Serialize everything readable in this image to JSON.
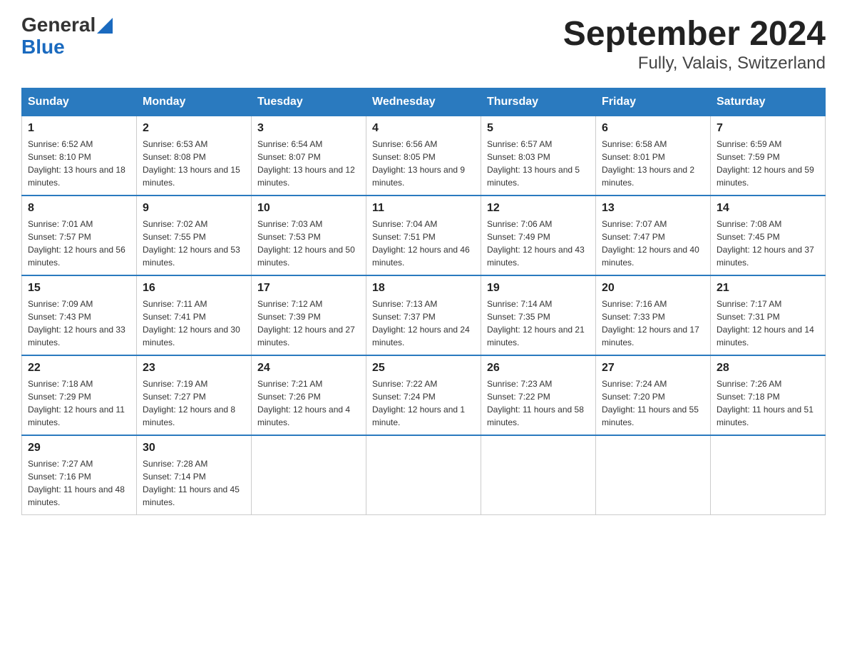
{
  "header": {
    "logo_general": "General",
    "logo_blue": "Blue",
    "month_year": "September 2024",
    "location": "Fully, Valais, Switzerland"
  },
  "days_of_week": [
    "Sunday",
    "Monday",
    "Tuesday",
    "Wednesday",
    "Thursday",
    "Friday",
    "Saturday"
  ],
  "weeks": [
    [
      {
        "day": "1",
        "sunrise": "6:52 AM",
        "sunset": "8:10 PM",
        "daylight": "13 hours and 18 minutes."
      },
      {
        "day": "2",
        "sunrise": "6:53 AM",
        "sunset": "8:08 PM",
        "daylight": "13 hours and 15 minutes."
      },
      {
        "day": "3",
        "sunrise": "6:54 AM",
        "sunset": "8:07 PM",
        "daylight": "13 hours and 12 minutes."
      },
      {
        "day": "4",
        "sunrise": "6:56 AM",
        "sunset": "8:05 PM",
        "daylight": "13 hours and 9 minutes."
      },
      {
        "day": "5",
        "sunrise": "6:57 AM",
        "sunset": "8:03 PM",
        "daylight": "13 hours and 5 minutes."
      },
      {
        "day": "6",
        "sunrise": "6:58 AM",
        "sunset": "8:01 PM",
        "daylight": "13 hours and 2 minutes."
      },
      {
        "day": "7",
        "sunrise": "6:59 AM",
        "sunset": "7:59 PM",
        "daylight": "12 hours and 59 minutes."
      }
    ],
    [
      {
        "day": "8",
        "sunrise": "7:01 AM",
        "sunset": "7:57 PM",
        "daylight": "12 hours and 56 minutes."
      },
      {
        "day": "9",
        "sunrise": "7:02 AM",
        "sunset": "7:55 PM",
        "daylight": "12 hours and 53 minutes."
      },
      {
        "day": "10",
        "sunrise": "7:03 AM",
        "sunset": "7:53 PM",
        "daylight": "12 hours and 50 minutes."
      },
      {
        "day": "11",
        "sunrise": "7:04 AM",
        "sunset": "7:51 PM",
        "daylight": "12 hours and 46 minutes."
      },
      {
        "day": "12",
        "sunrise": "7:06 AM",
        "sunset": "7:49 PM",
        "daylight": "12 hours and 43 minutes."
      },
      {
        "day": "13",
        "sunrise": "7:07 AM",
        "sunset": "7:47 PM",
        "daylight": "12 hours and 40 minutes."
      },
      {
        "day": "14",
        "sunrise": "7:08 AM",
        "sunset": "7:45 PM",
        "daylight": "12 hours and 37 minutes."
      }
    ],
    [
      {
        "day": "15",
        "sunrise": "7:09 AM",
        "sunset": "7:43 PM",
        "daylight": "12 hours and 33 minutes."
      },
      {
        "day": "16",
        "sunrise": "7:11 AM",
        "sunset": "7:41 PM",
        "daylight": "12 hours and 30 minutes."
      },
      {
        "day": "17",
        "sunrise": "7:12 AM",
        "sunset": "7:39 PM",
        "daylight": "12 hours and 27 minutes."
      },
      {
        "day": "18",
        "sunrise": "7:13 AM",
        "sunset": "7:37 PM",
        "daylight": "12 hours and 24 minutes."
      },
      {
        "day": "19",
        "sunrise": "7:14 AM",
        "sunset": "7:35 PM",
        "daylight": "12 hours and 21 minutes."
      },
      {
        "day": "20",
        "sunrise": "7:16 AM",
        "sunset": "7:33 PM",
        "daylight": "12 hours and 17 minutes."
      },
      {
        "day": "21",
        "sunrise": "7:17 AM",
        "sunset": "7:31 PM",
        "daylight": "12 hours and 14 minutes."
      }
    ],
    [
      {
        "day": "22",
        "sunrise": "7:18 AM",
        "sunset": "7:29 PM",
        "daylight": "12 hours and 11 minutes."
      },
      {
        "day": "23",
        "sunrise": "7:19 AM",
        "sunset": "7:27 PM",
        "daylight": "12 hours and 8 minutes."
      },
      {
        "day": "24",
        "sunrise": "7:21 AM",
        "sunset": "7:26 PM",
        "daylight": "12 hours and 4 minutes."
      },
      {
        "day": "25",
        "sunrise": "7:22 AM",
        "sunset": "7:24 PM",
        "daylight": "12 hours and 1 minute."
      },
      {
        "day": "26",
        "sunrise": "7:23 AM",
        "sunset": "7:22 PM",
        "daylight": "11 hours and 58 minutes."
      },
      {
        "day": "27",
        "sunrise": "7:24 AM",
        "sunset": "7:20 PM",
        "daylight": "11 hours and 55 minutes."
      },
      {
        "day": "28",
        "sunrise": "7:26 AM",
        "sunset": "7:18 PM",
        "daylight": "11 hours and 51 minutes."
      }
    ],
    [
      {
        "day": "29",
        "sunrise": "7:27 AM",
        "sunset": "7:16 PM",
        "daylight": "11 hours and 48 minutes."
      },
      {
        "day": "30",
        "sunrise": "7:28 AM",
        "sunset": "7:14 PM",
        "daylight": "11 hours and 45 minutes."
      },
      null,
      null,
      null,
      null,
      null
    ]
  ]
}
